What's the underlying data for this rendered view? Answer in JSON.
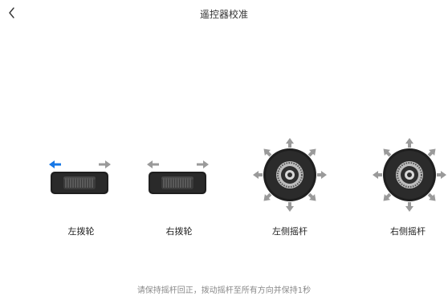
{
  "header": {
    "title": "遥控器校准",
    "back_icon": "chevron-left-icon"
  },
  "controls": [
    {
      "id": "left-dial",
      "label": "左拨轮",
      "icon": "dial-wheel-icon",
      "active_arrow": "left"
    },
    {
      "id": "right-dial",
      "label": "右拨轮",
      "icon": "dial-wheel-icon",
      "active_arrow": "none"
    },
    {
      "id": "left-stick",
      "label": "左侧摇杆",
      "icon": "joystick-icon"
    },
    {
      "id": "right-stick",
      "label": "右侧摇杆",
      "icon": "joystick-icon"
    }
  ],
  "instruction": "请保持摇杆回正，拨动摇杆至所有方向并保持1秒",
  "colors": {
    "accent_active": "#1677e6",
    "arrow_inactive": "#9a9a9a",
    "device_dark": "#1f1f1f",
    "title_text": "#333333",
    "hint_text": "#8a8a8a"
  }
}
